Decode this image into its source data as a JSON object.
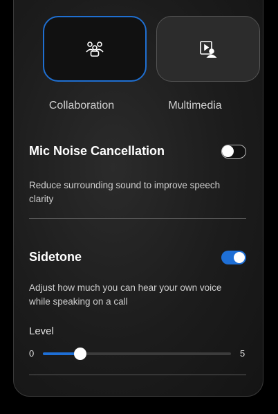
{
  "modes": [
    {
      "label": "Collaboration",
      "icon": "people-group-icon",
      "selected": true
    },
    {
      "label": "Multimedia",
      "icon": "media-presenter-icon",
      "selected": false
    }
  ],
  "mic_noise": {
    "title": "Mic Noise Cancellation",
    "description": "Reduce surrounding sound to improve speech clarity",
    "enabled": false
  },
  "sidetone": {
    "title": "Sidetone",
    "description": "Adjust how much you can hear your own voice while speaking on a call",
    "enabled": true,
    "level_label": "Level",
    "min_label": "0",
    "max_label": "5",
    "level_value": 1
  },
  "colors": {
    "accent": "#1e6fd6",
    "background": "#000000"
  }
}
